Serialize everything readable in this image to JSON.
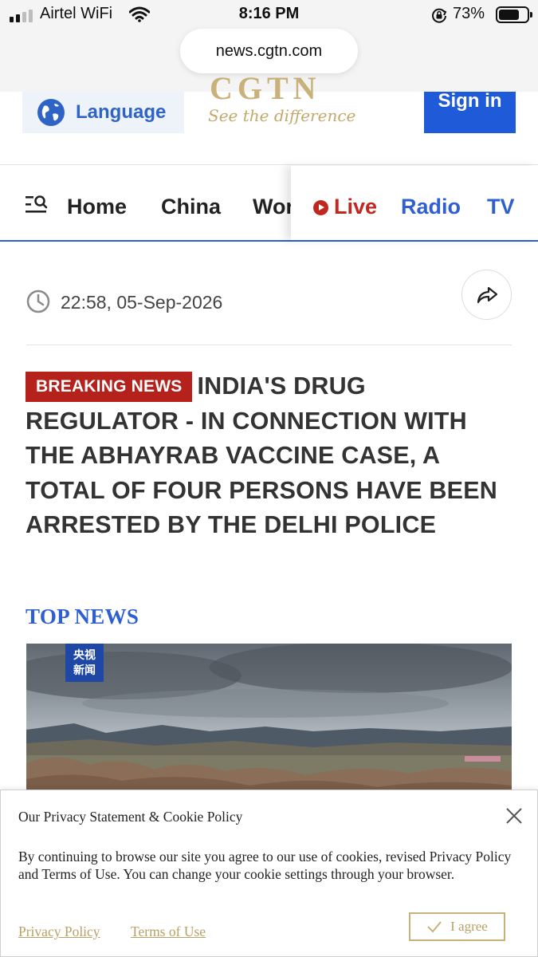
{
  "status_bar": {
    "carrier": "Airtel WiFi",
    "time": "8:16 PM",
    "battery_percent": "73%",
    "battery_level": 0.73,
    "signal_bars_on": 2,
    "signal_bars_total": 4
  },
  "browser": {
    "url": "news.cgtn.com"
  },
  "header": {
    "language_label": "Language",
    "logo_text": "CGTN",
    "logo_tagline": "See the difference",
    "signin_label": "Sign in"
  },
  "nav": {
    "items": [
      "Home",
      "China",
      "World"
    ],
    "live_label": "Live",
    "radio_label": "Radio",
    "tv_label": "TV"
  },
  "article": {
    "timestamp": "22:58, 05-Sep-2026",
    "badge": "BREAKING NEWS",
    "headline": "INDIA'S DRUG REGULATOR - IN CONNECTION WITH THE ABHAYRAB VACCINE CASE, A TOTAL OF FOUR PERSONS HAVE BEEN ARRESTED BY THE DELHI POLICE"
  },
  "top_news": {
    "heading": "TOP NEWS",
    "image_watermark_line1": "央视",
    "image_watermark_line2": "新闻"
  },
  "cookie_banner": {
    "title": "Our Privacy Statement & Cookie Policy",
    "body": "By continuing to browse our site you agree to our use of cookies, revised Privacy Policy and Terms of Use. You can change your cookie settings through your browser.",
    "privacy_link": "Privacy Policy",
    "terms_link": "Terms of Use",
    "agree_label": "I agree"
  },
  "colors": {
    "accent_blue": "#2f5fd0",
    "breaking_red": "#b5221c",
    "live_red": "#c0271e",
    "brand_gold": "#c9b27a"
  }
}
